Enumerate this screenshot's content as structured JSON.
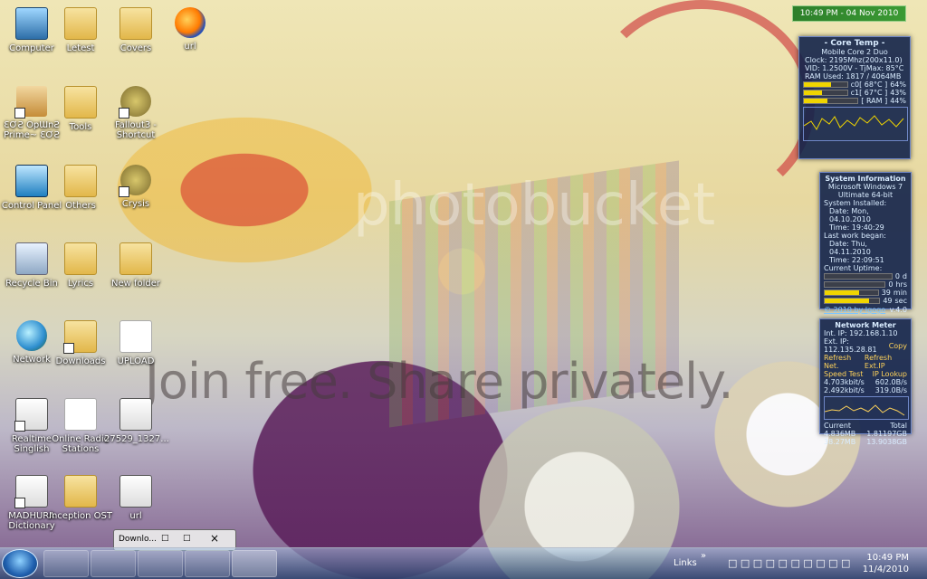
{
  "desktop_icons": [
    {
      "label": "Computer",
      "kind": "computer"
    },
    {
      "label": "Letest",
      "kind": "folder"
    },
    {
      "label": "Covers",
      "kind": "folder"
    },
    {
      "label": "url",
      "kind": "firefox"
    },
    {
      "label": "ƐƠƧ OpƜnƧ Prime~ ƐƠƧ",
      "kind": "user"
    },
    {
      "label": "Tools",
      "kind": "folder"
    },
    {
      "label": "Fallout3 - Shortcut",
      "kind": "game"
    },
    {
      "label": "Control Panel",
      "kind": "control-panel"
    },
    {
      "label": "Others",
      "kind": "folder"
    },
    {
      "label": "Crysis",
      "kind": "game"
    },
    {
      "label": "Recycle Bin",
      "kind": "recycle-bin"
    },
    {
      "label": "Lyrics",
      "kind": "folder"
    },
    {
      "label": "New folder",
      "kind": "folder"
    },
    {
      "label": "Network",
      "kind": "network"
    },
    {
      "label": "Downloads",
      "kind": "folder"
    },
    {
      "label": "UPLOAD",
      "kind": "document"
    },
    {
      "label": "Realtime Singlish",
      "kind": "app"
    },
    {
      "label": "Online Radio Stations",
      "kind": "document"
    },
    {
      "label": "27529_1327...",
      "kind": "app"
    },
    {
      "label": "MADHURA Dictionary",
      "kind": "app"
    },
    {
      "label": "Inception OST",
      "kind": "folder"
    },
    {
      "label": "url",
      "kind": "image"
    }
  ],
  "watermark": {
    "brand": "photobucket",
    "slogan": "Join free. Share privately."
  },
  "clock_gadget": {
    "text": "10:49 PM - 04 Nov 2010"
  },
  "core_temp": {
    "title": "- Core Temp -",
    "cpu": "Mobile Core 2 Duo",
    "clock": "Clock: 2195Mhz(200x11.0)",
    "vid": "VID: 1.2500V - TjMax: 85°C",
    "ram": "RAM Used: 1817 / 4064MB",
    "cores": [
      {
        "label": "c0[ 68°C ]",
        "percent": "64%",
        "value": 64
      },
      {
        "label": "c1[ 67°C ]",
        "percent": "43%",
        "value": 43
      },
      {
        "label": "[ RAM ]",
        "percent": "44%",
        "value": 44
      }
    ]
  },
  "system_info": {
    "title": "System Information",
    "os": "Microsoft Windows 7",
    "edition": "Ultimate 64-bit",
    "installed_label": "System Installed:",
    "installed_date": "Date: Mon, 04.10.2010",
    "installed_time": "Time: 19:40:29",
    "last_work_label": "Last work began:",
    "last_work_date": "Date: Thu, 04.11.2010",
    "last_work_time": "Time: 22:09:51",
    "uptime_label": "Current Uptime:",
    "uptime": [
      {
        "value": "0",
        "unit": "d",
        "fill": 0
      },
      {
        "value": "0",
        "unit": "hrs",
        "fill": 0
      },
      {
        "value": "39",
        "unit": "min",
        "fill": 0.65
      },
      {
        "value": "49",
        "unit": "sec",
        "fill": 0.82
      }
    ],
    "credit": "© 2010 by Igogo",
    "version": "v.4.0"
  },
  "network_meter": {
    "title": "Network Meter",
    "int_ip": "Int. IP: 192.168.1.10",
    "ext_ip": "Ext. IP: 112.135.28.81",
    "copy": "Copy",
    "refresh_net": "Refresh Net.",
    "refresh_ext": "Refresh Ext.IP",
    "speed_test": "Speed Test",
    "ip_lookup": "IP Lookup",
    "up_rate": "4.703kbit/s",
    "up_bytes": "602.0B/s",
    "down_rate": "2.492kbit/s",
    "down_bytes": "319.0B/s",
    "current_label": "Current",
    "total_label": "Total",
    "current_up": "4.836MB",
    "current_down": "38.27MB",
    "total_up": "1.81197GB",
    "total_down": "13.9038GB"
  },
  "popup": {
    "label": "Downlo...",
    "min": "□",
    "max": "□",
    "close": "×"
  },
  "taskbar": {
    "links_label": "Links",
    "chevron": "»",
    "time": "10:49 PM",
    "date": "11/4/2010"
  },
  "colors": {
    "accent": "#3b9a34",
    "gadget_bg": "#12224a",
    "taskbar": "#284a6e"
  }
}
